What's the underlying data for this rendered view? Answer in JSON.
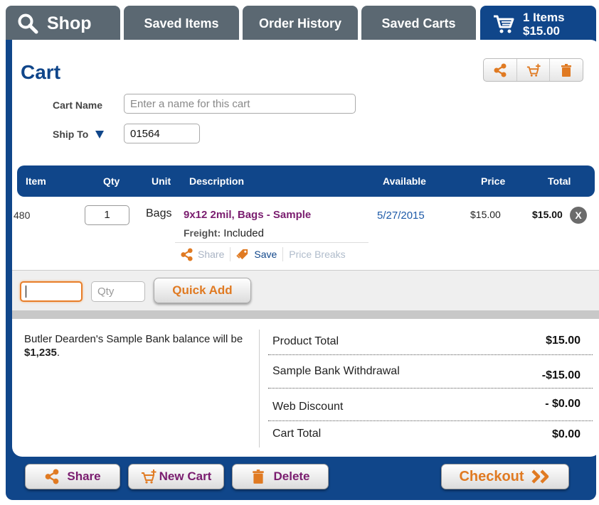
{
  "tabs": {
    "shop": "Shop",
    "saved_items": "Saved Items",
    "order_history": "Order History",
    "saved_carts": "Saved Carts",
    "cart_count": "1 Items",
    "cart_amount": "$15.00"
  },
  "cart": {
    "title": "Cart",
    "name_label": "Cart Name",
    "name_placeholder": "Enter a name for this cart",
    "ship_label": "Ship To",
    "ship_value": "01564"
  },
  "table": {
    "headers": {
      "item": "Item",
      "qty": "Qty",
      "unit": "Unit",
      "description": "Description",
      "available": "Available",
      "price": "Price",
      "total": "Total"
    },
    "rows": [
      {
        "item": "480",
        "qty": "1",
        "unit": "Bags",
        "description": "9x12 2mil, Bags - Sample",
        "freight_label": "Freight:",
        "freight_value": "Included",
        "available": "5/27/2015",
        "price": "$15.00",
        "total": "$15.00",
        "remove": "X",
        "actions": {
          "share": "Share",
          "save": "Save",
          "price_breaks": "Price Breaks"
        }
      }
    ]
  },
  "quick_add": {
    "qty_placeholder": "Qty",
    "button": "Quick Add"
  },
  "summary": {
    "balance_text": "Butler Dearden's Sample Bank balance will be",
    "balance_amount": "$1,235",
    "balance_end": ".",
    "rows": [
      {
        "label": "Product Total",
        "value": "$15.00"
      },
      {
        "label": "Sample Bank Withdrawal",
        "value": "-$15.00"
      },
      {
        "label": "Web Discount",
        "value": "- $0.00"
      },
      {
        "label": "Cart Total",
        "value": "$0.00"
      }
    ]
  },
  "footer": {
    "share": "Share",
    "new_cart": "New Cart",
    "delete": "Delete",
    "checkout": "Checkout"
  },
  "colors": {
    "brand_blue": "#10468a",
    "tab_grey": "#5b6872",
    "accent_orange": "#e07a22",
    "accent_purple": "#7a1d6f"
  }
}
